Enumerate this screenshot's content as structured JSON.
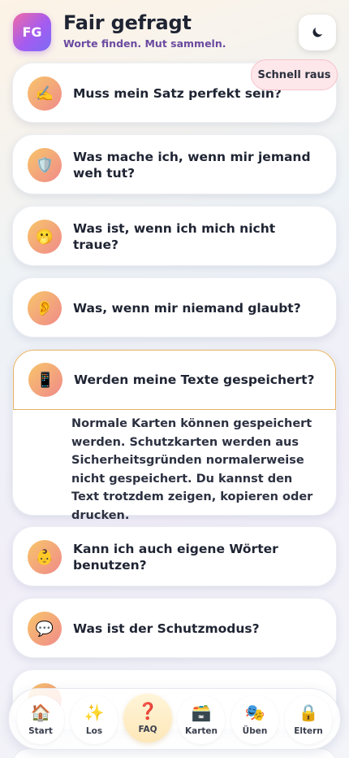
{
  "app": {
    "logo_text": "FG",
    "title": "Fair gefragt",
    "subtitle": "Worte finden. Mut sammeln.",
    "theme_icon": "moon-icon",
    "quick_exit_label": "Schnell raus"
  },
  "faq": [
    {
      "icon": "✍️",
      "icon_name": "writing-hand-icon",
      "question": "Muss mein Satz perfekt sein?"
    },
    {
      "icon": "🛡️",
      "icon_name": "shield-icon",
      "question": "Was mache ich, wenn mir jemand weh tut?"
    },
    {
      "icon": "🫢",
      "icon_name": "face-hand-over-mouth-icon",
      "question": "Was ist, wenn ich mich nicht traue?"
    },
    {
      "icon": "👂",
      "icon_name": "ear-icon",
      "question": "Was, wenn mir niemand glaubt?"
    },
    {
      "icon": "📱",
      "icon_name": "phone-icon",
      "question": "Werden meine Texte gespeichert?",
      "expanded": true,
      "answer": "Normale Karten können gespeichert werden. Schutzkarten werden aus Sicherheitsgründen normalerweise nicht gespeichert. Du kannst den Text trotzdem zeigen, kopieren oder drucken."
    },
    {
      "icon": "👶",
      "icon_name": "child-icon",
      "question": "Kann ich auch eigene Wörter benutzen?"
    },
    {
      "icon": "💬",
      "icon_name": "speech-bubble-icon",
      "question": "Was ist der Schutzmodus?"
    }
  ],
  "nav": [
    {
      "icon": "🏠",
      "icon_name": "house-icon",
      "label": "Start"
    },
    {
      "icon": "✨",
      "icon_name": "sparkles-icon",
      "label": "Los"
    },
    {
      "icon": "❓",
      "icon_name": "question-mark-icon",
      "label": "FAQ",
      "active": true
    },
    {
      "icon": "🗃️",
      "icon_name": "card-box-icon",
      "label": "Karten"
    },
    {
      "icon": "🎭",
      "icon_name": "theater-masks-icon",
      "label": "Üben"
    },
    {
      "icon": "🔒",
      "icon_name": "lock-icon",
      "label": "Eltern"
    }
  ],
  "colors": {
    "accent_gradient_start": "#f06aa7",
    "accent_gradient_end": "#7b6cf6",
    "open_card_border": "#e7b163",
    "quick_exit_bg": "#fde7ea"
  }
}
